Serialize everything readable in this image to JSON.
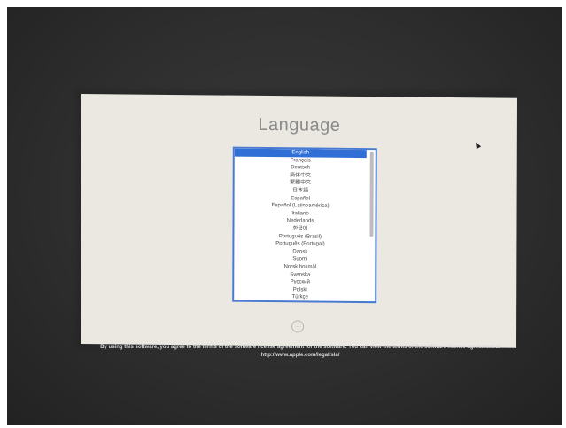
{
  "title": "Language",
  "languages": [
    "English",
    "Français",
    "Deutsch",
    "简体中文",
    "繁體中文",
    "日本語",
    "Español",
    "Español (Latinoamérica)",
    "Italiano",
    "Nederlands",
    "한국어",
    "Português (Brasil)",
    "Português (Portugal)",
    "Dansk",
    "Suomi",
    "Norsk bokmål",
    "Svenska",
    "Русский",
    "Polski",
    "Türkçe"
  ],
  "selected_index": 0,
  "continue_arrow": "→",
  "icons": {
    "continue": "arrow-right-circle-icon",
    "cursor": "mouse-pointer-icon"
  },
  "license_text": "By using this software, you agree to the terms of the software license agreement for the software. You can view the terms of the software license agreement at http://www.apple.com/legal/sla/",
  "colors": {
    "selection": "#2f6fd6",
    "panel": "#ebe8e2",
    "background": "#2e2e2e"
  }
}
